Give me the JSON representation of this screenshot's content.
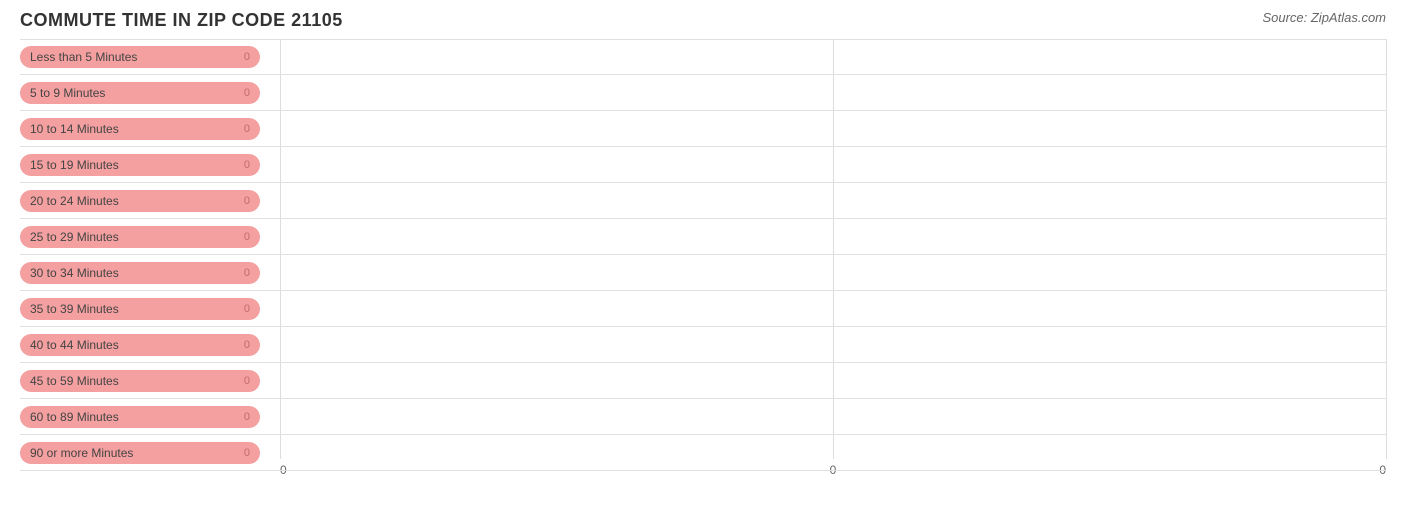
{
  "chart": {
    "title": "COMMUTE TIME IN ZIP CODE 21105",
    "source": "Source: ZipAtlas.com",
    "bars": [
      {
        "label": "Less than 5 Minutes",
        "value": 0
      },
      {
        "label": "5 to 9 Minutes",
        "value": 0
      },
      {
        "label": "10 to 14 Minutes",
        "value": 0
      },
      {
        "label": "15 to 19 Minutes",
        "value": 0
      },
      {
        "label": "20 to 24 Minutes",
        "value": 0
      },
      {
        "label": "25 to 29 Minutes",
        "value": 0
      },
      {
        "label": "30 to 34 Minutes",
        "value": 0
      },
      {
        "label": "35 to 39 Minutes",
        "value": 0
      },
      {
        "label": "40 to 44 Minutes",
        "value": 0
      },
      {
        "label": "45 to 59 Minutes",
        "value": 0
      },
      {
        "label": "60 to 89 Minutes",
        "value": 0
      },
      {
        "label": "90 or more Minutes",
        "value": 0
      }
    ],
    "xAxisLabels": [
      "0",
      "0",
      "0"
    ],
    "xAxisPositions": [
      0,
      50,
      100
    ]
  }
}
